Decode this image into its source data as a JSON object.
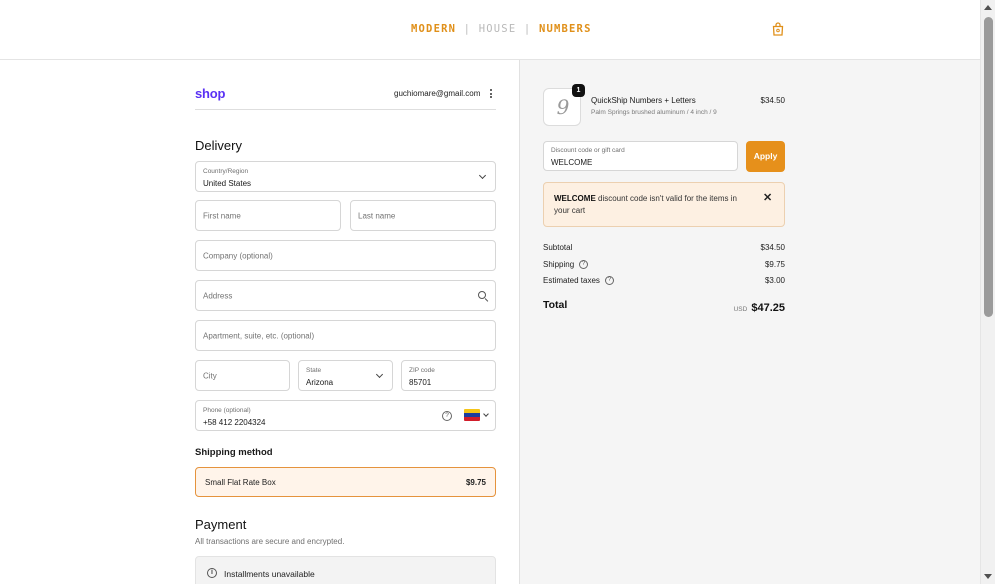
{
  "brand": {
    "part1": "MODERN",
    "separator": "|",
    "part2": "HOUSE",
    "part3": "NUMBERS",
    "accent_color": "#e0901a"
  },
  "header": {
    "cart_icon": "shopping-bag-icon"
  },
  "account": {
    "shop_label": "shop",
    "email": "guchiomare@gmail.com",
    "menu_icon": "kebab-menu-icon"
  },
  "delivery": {
    "title": "Delivery",
    "country": {
      "label": "Country/Region",
      "value": "United States"
    },
    "first_name": {
      "placeholder": "First name"
    },
    "last_name": {
      "placeholder": "Last name"
    },
    "company": {
      "placeholder": "Company (optional)"
    },
    "address": {
      "placeholder": "Address"
    },
    "apartment": {
      "placeholder": "Apartment, suite, etc. (optional)"
    },
    "city": {
      "placeholder": "City"
    },
    "state": {
      "label": "State",
      "value": "Arizona"
    },
    "zip": {
      "label": "ZIP code",
      "value": "85701"
    },
    "phone": {
      "label": "Phone (optional)",
      "value": "+58 412 2204324",
      "help": "?"
    }
  },
  "shipping": {
    "title": "Shipping method",
    "option": {
      "name": "Small Flat Rate Box",
      "price": "$9.75"
    }
  },
  "payment": {
    "title": "Payment",
    "subtitle": "All transactions are secure and encrypted.",
    "installments": {
      "icon": "i",
      "text": "Installments unavailable"
    }
  },
  "order": {
    "item": {
      "quantity": "1",
      "thumb_glyph": "9",
      "name": "QuickShip Numbers + Letters",
      "variant": "Palm Springs brushed aluminum / 4 inch / 9",
      "price": "$34.50"
    },
    "discount": {
      "label": "Discount code or gift card",
      "value": "WELCOME",
      "apply_label": "Apply",
      "apply_color": "#e6901b"
    },
    "error": {
      "code": "WELCOME",
      "message": " discount code isn't valid for the items in your cart",
      "close": "✕"
    },
    "summary": {
      "subtotal_label": "Subtotal",
      "subtotal_value": "$34.50",
      "shipping_label": "Shipping",
      "shipping_value": "$9.75",
      "taxes_label": "Estimated taxes",
      "taxes_value": "$3.00",
      "help": "?",
      "total_label": "Total",
      "total_currency": "USD",
      "total_value": "$47.25"
    }
  }
}
